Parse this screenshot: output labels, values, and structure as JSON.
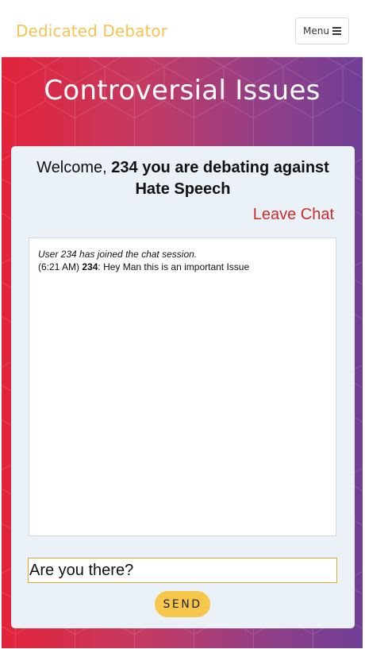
{
  "navbar": {
    "brand": "Dedicated Debator",
    "menu_label": "Menu",
    "menu_icon": "bars-icon"
  },
  "hero": {
    "title": "Controversial Issues"
  },
  "chat": {
    "welcome_prefix": "Welcome,",
    "welcome_user_phrase": "234 you are debating against",
    "topic": "Hate Speech",
    "leave_label": "Leave Chat",
    "messages": {
      "system": "User 234 has joined the chat session.",
      "time": "(6:21 AM)",
      "user": "234",
      "text": ": Hey Man this is an important Issue"
    },
    "input_value": "Are you there?",
    "send_label": "SEND"
  },
  "colors": {
    "brand": "#f5c451",
    "leave": "#d02b2b",
    "send": "#f7c74b",
    "gradient_start": "#e3233a",
    "gradient_end": "#6f3f95"
  }
}
